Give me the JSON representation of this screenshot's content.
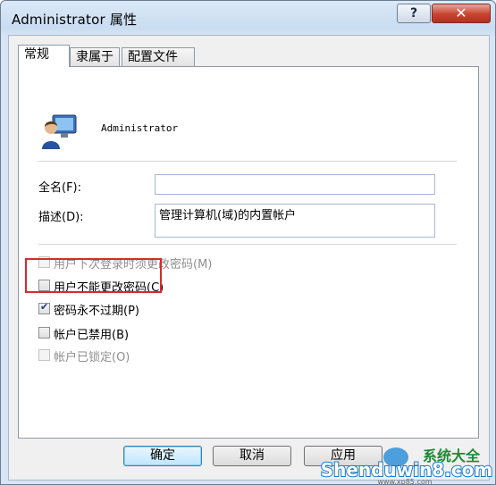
{
  "window": {
    "title": "Administrator 属性",
    "help_label": "?",
    "close_label": "✕"
  },
  "tabs": [
    {
      "label": "常规",
      "active": true
    },
    {
      "label": "隶属于",
      "active": false
    },
    {
      "label": "配置文件",
      "active": false
    }
  ],
  "general": {
    "username": "Administrator",
    "fullname_label": "全名(F):",
    "fullname_value": "",
    "description_label": "描述(D):",
    "description_value": "管理计算机(域)的内置帐户"
  },
  "options": [
    {
      "label": "用户下次登录时须更改密码(M)",
      "checked": false,
      "enabled": false
    },
    {
      "label": "用户不能更改密码(C)",
      "checked": false,
      "enabled": true
    },
    {
      "label": "密码永不过期(P)",
      "checked": true,
      "enabled": true
    },
    {
      "label": "帐户已禁用(B)",
      "checked": false,
      "enabled": true
    },
    {
      "label": "帐户已锁定(O)",
      "checked": false,
      "enabled": false
    }
  ],
  "buttons": {
    "ok": "确定",
    "cancel": "取消",
    "apply": "应用"
  },
  "watermark": {
    "text": "Shenduwin8.com",
    "sub": "www.xp85.com",
    "cn": "系统大全"
  },
  "colors": {
    "highlight": "#d9282f",
    "title_bar": "#c9dcf1"
  }
}
